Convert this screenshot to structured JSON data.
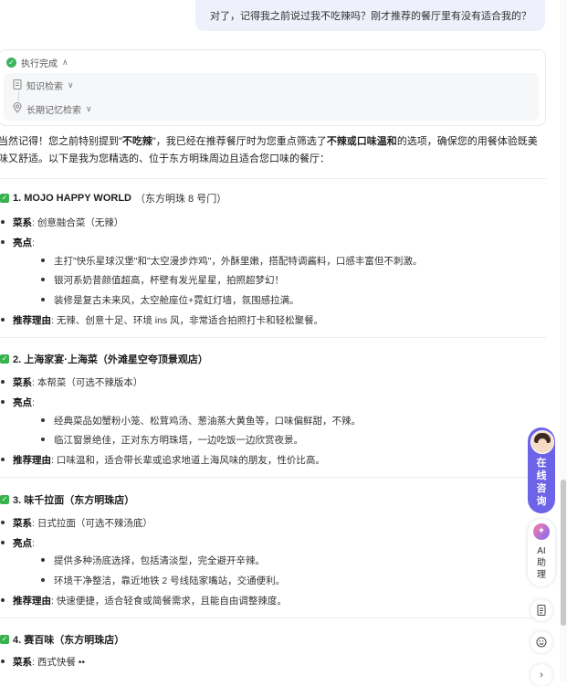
{
  "user_message": "对了，记得我之前说过我不吃辣吗？刚才推荐的餐厅里有没有适合我的？",
  "exec": {
    "status": "执行完成",
    "steps": [
      "知识检索",
      "长期记忆检索"
    ]
  },
  "intro": {
    "p1": "当然记得！您之前特别提到\"",
    "b1": "不吃辣",
    "p2": "\"，我已经在推荐餐厅时为您重点筛选了",
    "b2": "不辣或口味温和",
    "p3": "的选项，确保您的用餐体验既美",
    "line2": "味又舒适。以下是我为您精选的、位于东方明珠周边且适合您口味的餐厅："
  },
  "restaurants": [
    {
      "title": "1. MOJO HAPPY WORLD",
      "addr": "（东方明珠 8 号门）",
      "cuisine_label": "菜系",
      "cuisine": ": 创意融合菜（无辣）",
      "highlight_label": "亮点",
      "highlights": [
        "主打\"快乐星球汉堡\"和\"太空漫步炸鸡\"，外酥里嫩，搭配特调酱料，口感丰富但不刺激。",
        "银河系奶昔颜值超高，杯壁有发光星星，拍照超梦幻！",
        "装修是复古未来风，太空舱座位+霓虹灯墙，氛围感拉满。"
      ],
      "reason_label": "推荐理由",
      "reason": ": 无辣、创意十足、环境 ins 风，非常适合拍照打卡和轻松聚餐。"
    },
    {
      "title": "2. 上海家宴·上海菜（外滩星空夸顶景观店）",
      "addr": "",
      "cuisine_label": "菜系",
      "cuisine": ": 本帮菜（可选不辣版本）",
      "highlight_label": "亮点",
      "highlights": [
        "经典菜品如蟹粉小笼、松茸鸡汤、葱油蒸大黄鱼等，口味偏鲜甜，不辣。",
        "临江窗景绝佳，正对东方明珠塔，一边吃饭一边欣赏夜景。"
      ],
      "reason_label": "推荐理由",
      "reason": ": 口味温和，适合带长辈或追求地道上海风味的朋友，性价比高。"
    },
    {
      "title": "3. 味千拉面（东方明珠店）",
      "addr": "",
      "cuisine_label": "菜系",
      "cuisine": ": 日式拉面（可选不辣汤底）",
      "highlight_label": "亮点",
      "highlights": [
        "提供多种汤底选择，包括清淡型，完全避开辛辣。",
        "环境干净整洁，靠近地铁 2 号线陆家嘴站，交通便利。"
      ],
      "reason_label": "推荐理由",
      "reason": ": 快速便捷，适合轻食或简餐需求，且能自由调整辣度。"
    },
    {
      "title": "4. 赛百味（东方明珠店）",
      "addr": "",
      "cuisine_label": "菜系",
      "cuisine": ": 西式快餐 ••"
    }
  ],
  "side": {
    "consult_chars": [
      "在",
      "线",
      "咨",
      "询"
    ],
    "ai_chars": [
      "AI",
      "助",
      "理"
    ]
  }
}
